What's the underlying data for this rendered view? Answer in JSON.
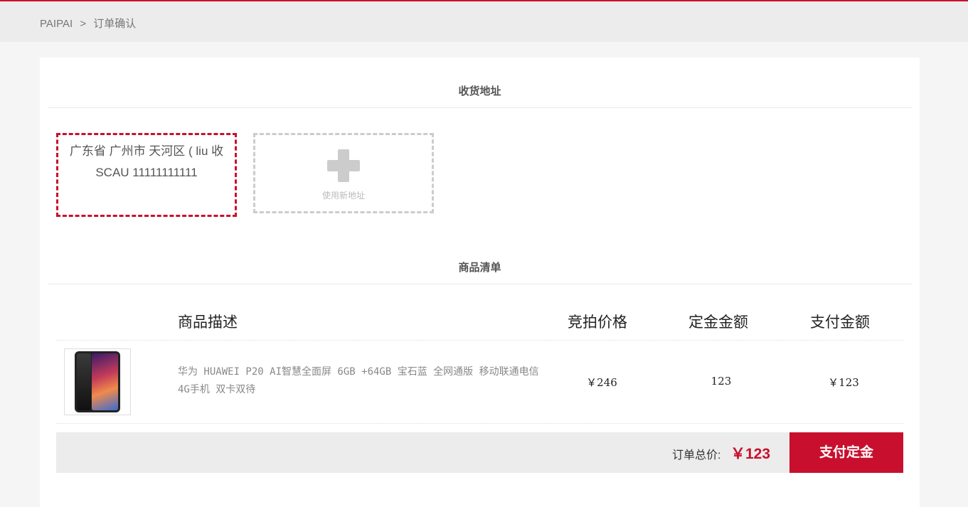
{
  "breadcrumb": {
    "root": "PAIPAI",
    "separator": ">",
    "current": "订单确认"
  },
  "address_section": {
    "title": "收货地址",
    "selected_address": {
      "line1": "广东省 广州市 天河区 ( liu 收",
      "line2": "SCAU 11111111111"
    },
    "new_address_label": "使用新地址"
  },
  "items_section": {
    "title": "商品清单",
    "columns": {
      "description": "商品描述",
      "auction_price": "竞拍价格",
      "deposit_amount": "定金金额",
      "pay_amount": "支付金额"
    },
    "items": [
      {
        "description": "华为 HUAWEI P20 AI智慧全面屏 6GB +64GB 宝石蓝 全网通版 移动联通电信4G手机 双卡双待",
        "auction_price": "￥246",
        "deposit_amount": "123",
        "pay_amount": "￥123"
      }
    ]
  },
  "summary": {
    "total_label": "订单总价:",
    "total_value": "￥123",
    "pay_button": "支付定金"
  },
  "colors": {
    "accent": "#c8102e",
    "footer_bg": "#ececec"
  }
}
